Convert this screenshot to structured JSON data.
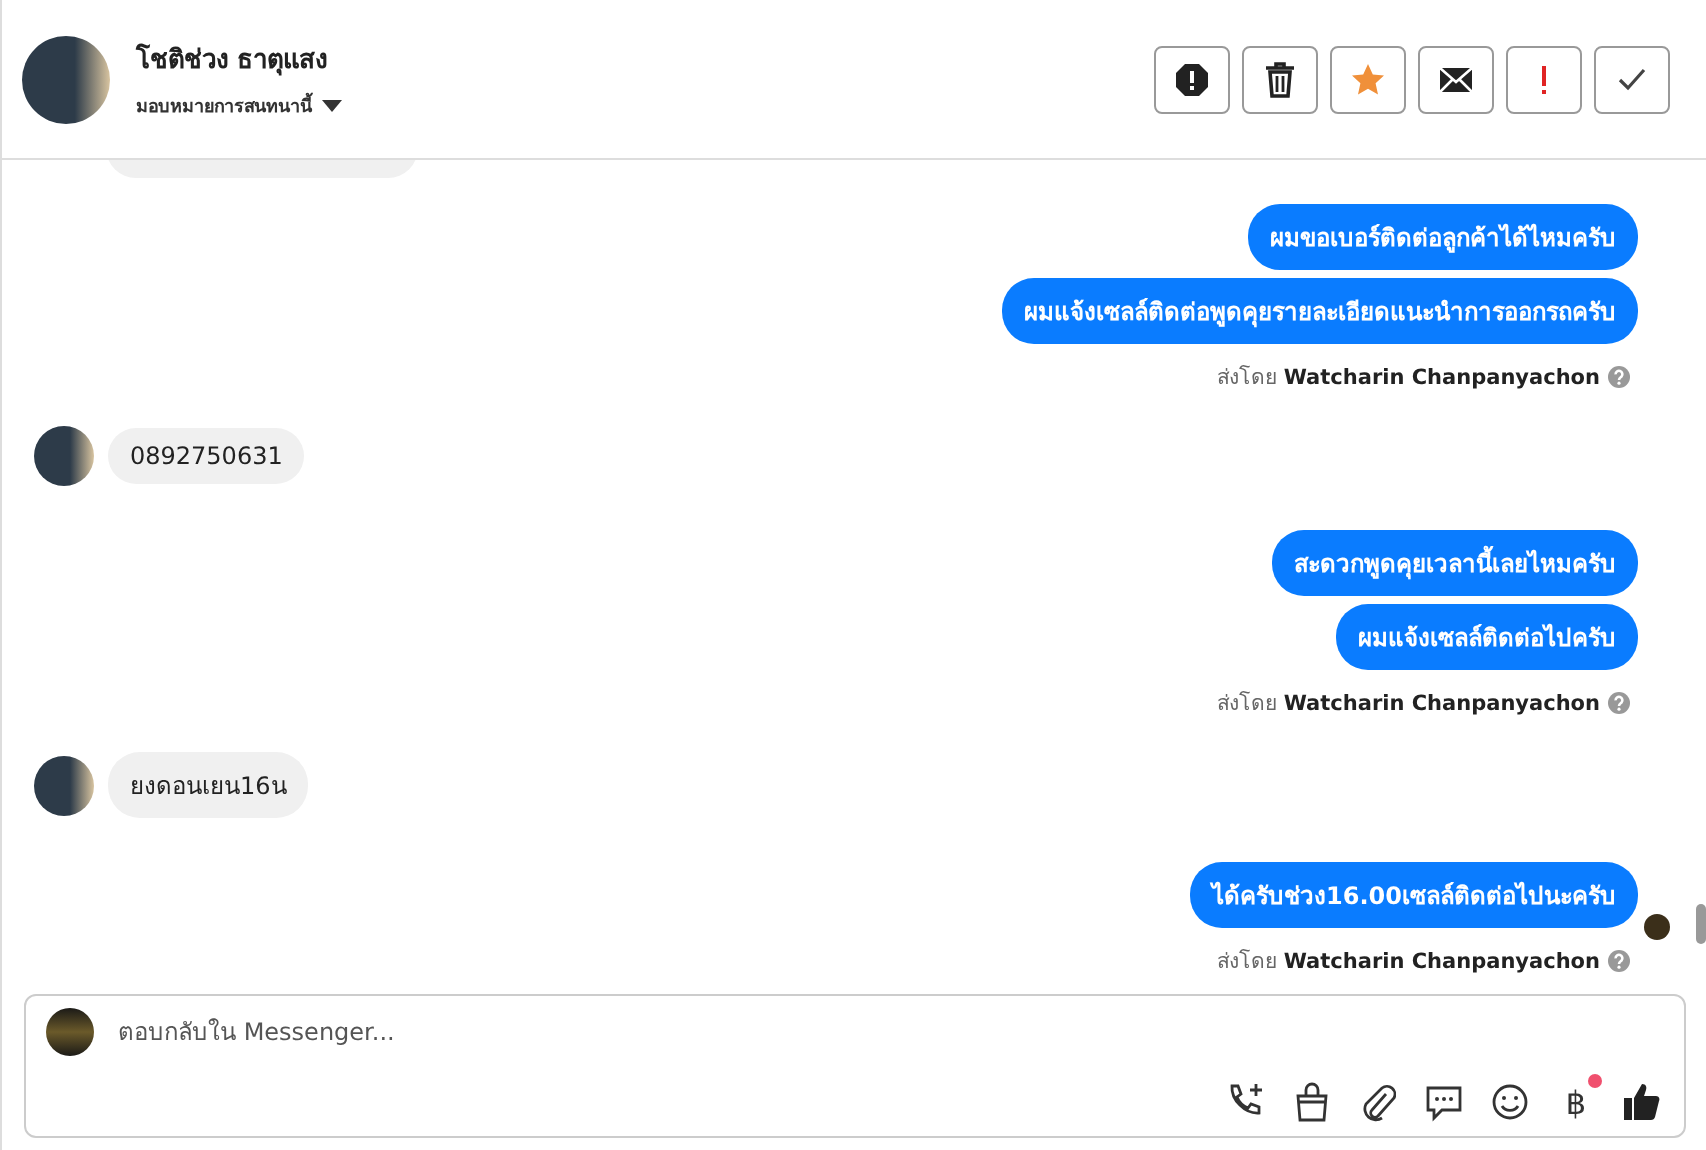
{
  "header": {
    "name": "โชติช่วง ธาตุแสง",
    "assign_label": "มอบหมายการสนทนานี้",
    "actions": [
      {
        "kind": "alert"
      },
      {
        "kind": "trash"
      },
      {
        "kind": "star"
      },
      {
        "kind": "mail"
      },
      {
        "kind": "exclaim"
      },
      {
        "kind": "check"
      }
    ]
  },
  "messages": [
    {
      "kind": "outgoing",
      "bubbles": [
        "ผมขอเบอร์ติดต่อลูกค้าได้ไหมครับ",
        "ผมแจ้งเซลล์ติดต่อพูดคุยรายละเอียดแนะนำการออกรถครับ"
      ],
      "sent_by": "ส่งโดย",
      "sender": "Watcharin Chanpanyachon"
    },
    {
      "kind": "incoming",
      "text": "0892750631"
    },
    {
      "kind": "outgoing",
      "bubbles": [
        "สะดวกพูดคุยเวลานี้เลยไหมครับ",
        "ผมแจ้งเซลล์ติดต่อไปครับ"
      ],
      "sent_by": "ส่งโดย",
      "sender": "Watcharin Chanpanyachon"
    },
    {
      "kind": "incoming",
      "text": "ยงดอนเยน16น"
    },
    {
      "kind": "outgoing",
      "bubbles": [
        "ได้ครับช่วง16.00เซลล์ติดต่อไปนะครับ"
      ],
      "sent_by": "ส่งโดย",
      "sender": "Watcharin Chanpanyachon",
      "seen": true
    }
  ],
  "composer": {
    "placeholder": "ตอบกลับใน Messenger...",
    "baht": "฿",
    "tools": [
      {
        "kind": "call"
      },
      {
        "kind": "bag"
      },
      {
        "kind": "clip"
      },
      {
        "kind": "chat"
      },
      {
        "kind": "smile"
      },
      {
        "kind": "baht",
        "badge": true
      },
      {
        "kind": "like"
      }
    ]
  }
}
